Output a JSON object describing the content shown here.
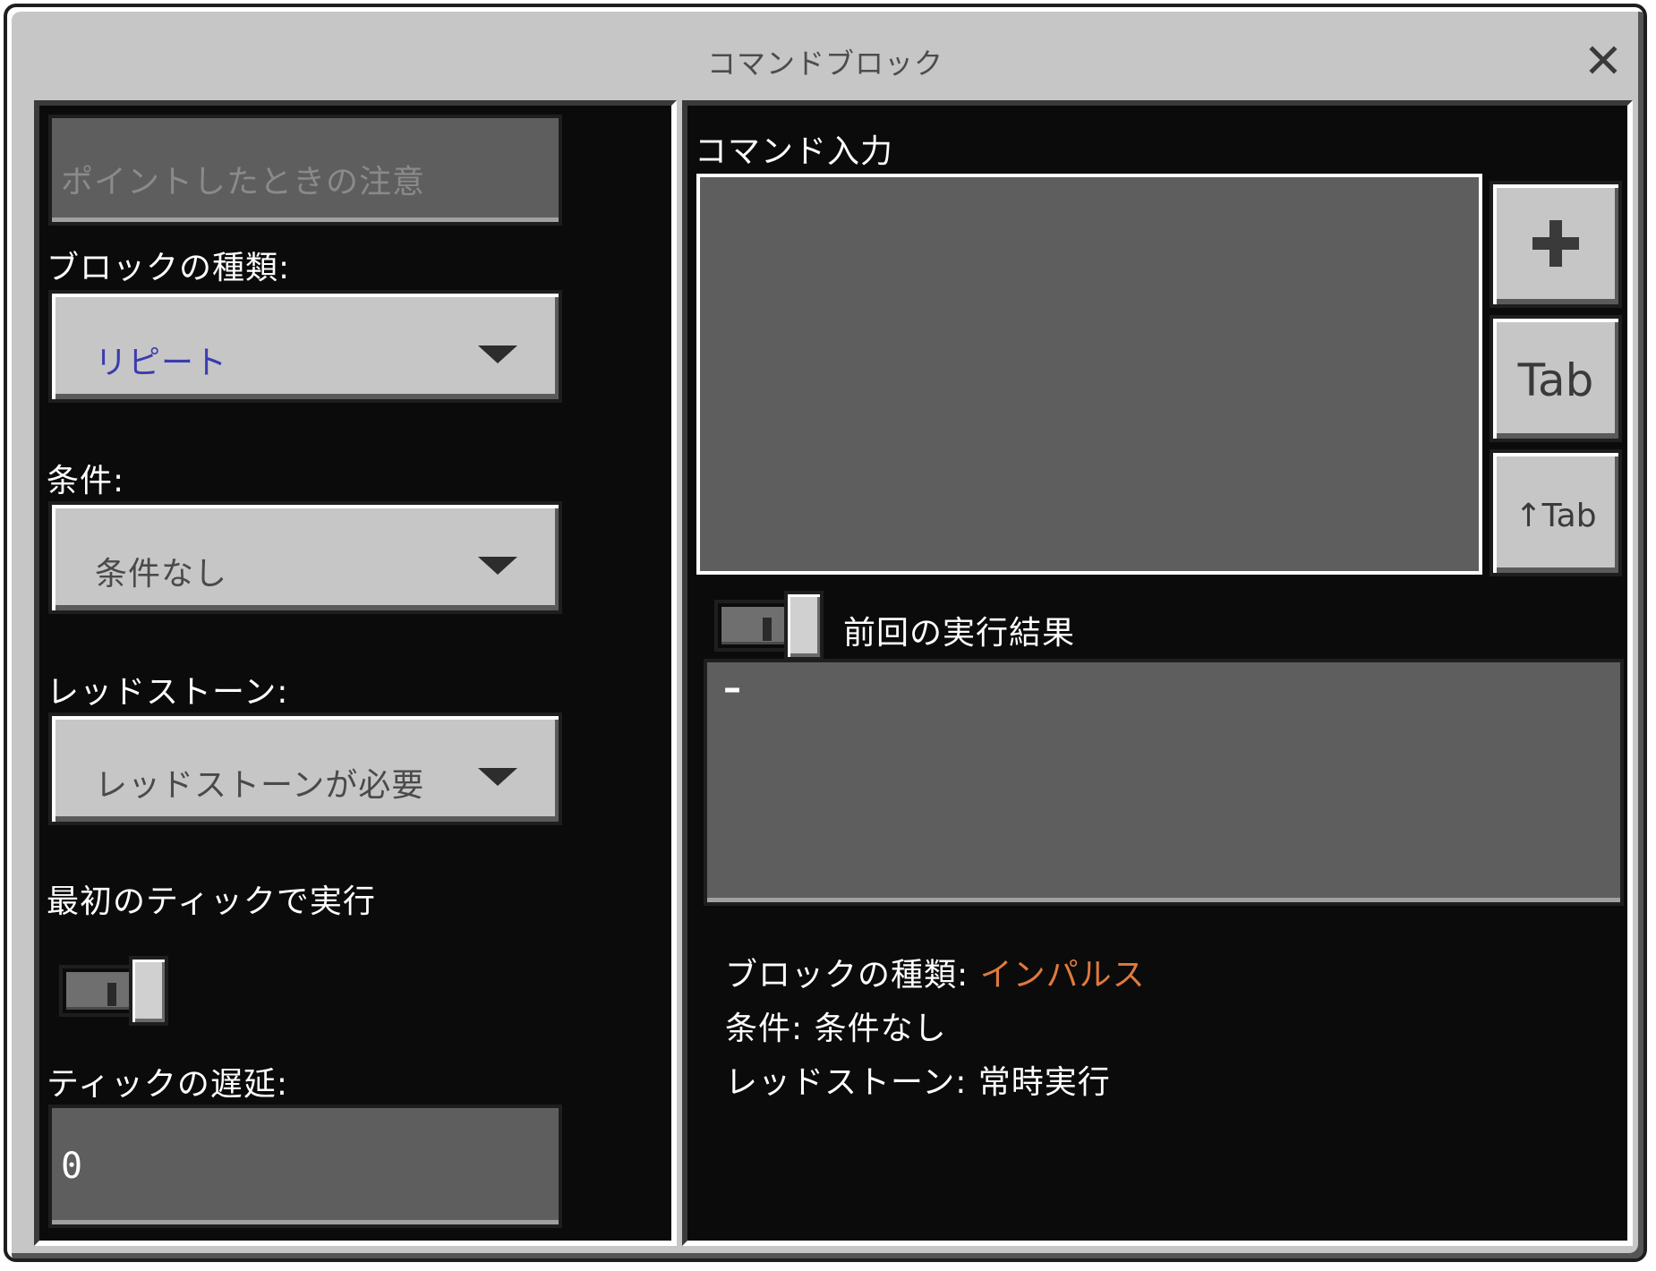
{
  "window": {
    "title": "コマンドブロック"
  },
  "left": {
    "hover_note_placeholder": "ポイントしたときの注意",
    "block_type": {
      "label": "ブロックの種類:",
      "value": "リピート"
    },
    "condition": {
      "label": "条件:",
      "value": "条件なし"
    },
    "redstone": {
      "label": "レッドストーン:",
      "value": "レッドストーンが必要"
    },
    "execute_first_tick": {
      "label": "最初のティックで実行",
      "state": "off"
    },
    "tick_delay": {
      "label": "ティックの遅延:",
      "value": "0"
    }
  },
  "right": {
    "command_input_label": "コマンド入力",
    "command_value": "",
    "buttons": {
      "add": "+",
      "tab": "Tab",
      "shift_tab": "↑Tab"
    },
    "previous_output": {
      "label": "前回の実行結果",
      "state": "off",
      "value": "–"
    },
    "info": {
      "block_type_label": "ブロックの種類:",
      "block_type_value": "インパルス",
      "condition_label": "条件:",
      "condition_value": "条件なし",
      "redstone_label": "レッドストーン:",
      "redstone_value": "常時実行"
    }
  },
  "colors": {
    "window_bg": "#c6c6c6",
    "panel_bg": "#0b0b0b",
    "dropdown_selected_text": "#3b3baf",
    "impulse_text": "#e07a3c"
  }
}
